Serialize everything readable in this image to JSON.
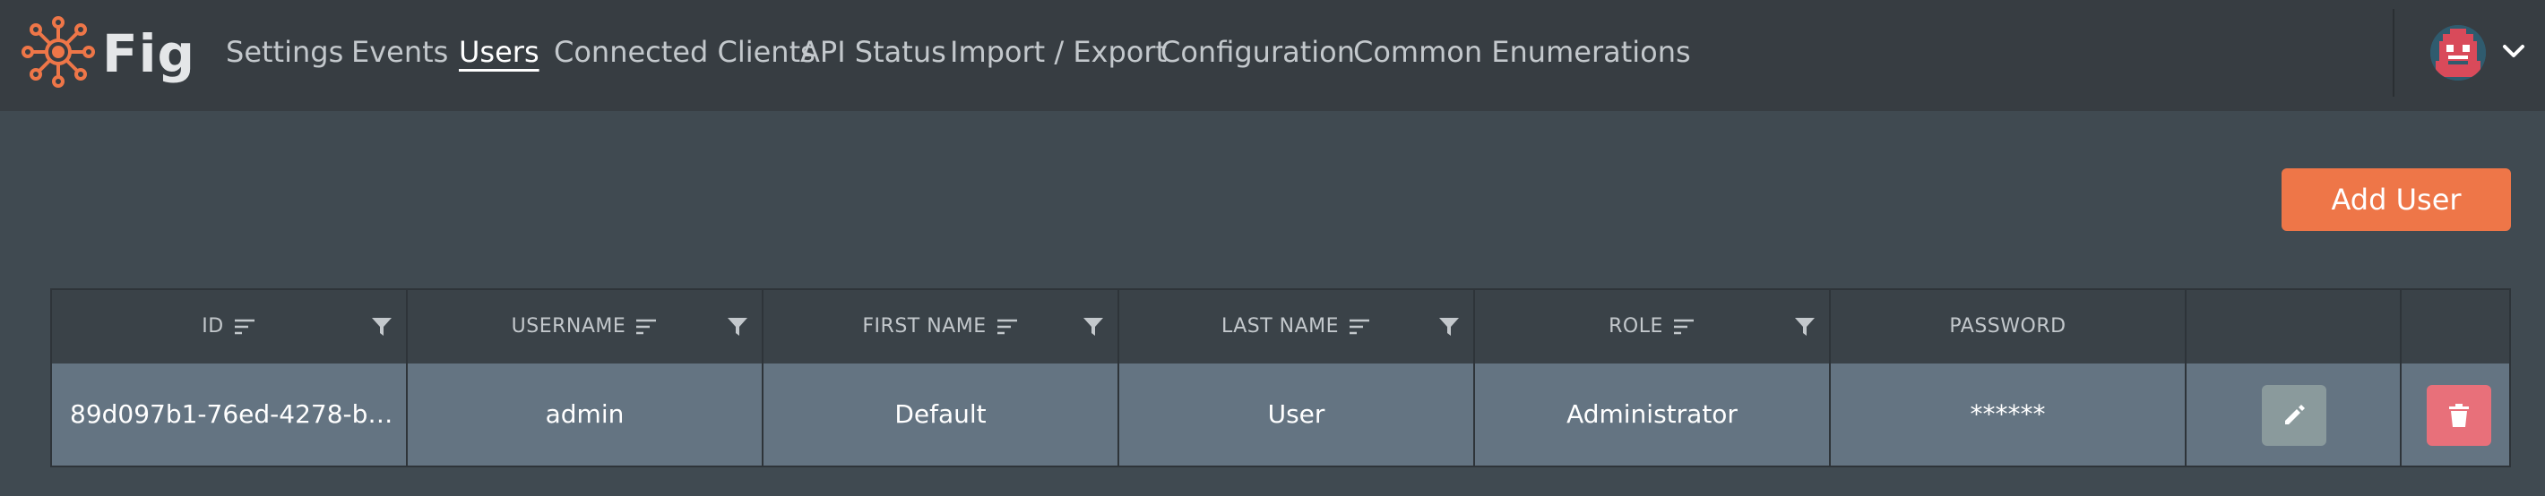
{
  "app": {
    "brand": "Fig"
  },
  "nav": {
    "items": [
      {
        "label": "Settings",
        "active": false
      },
      {
        "label": "Events",
        "active": false
      },
      {
        "label": "Users",
        "active": true
      },
      {
        "label": "Connected Clients",
        "active": false
      },
      {
        "label": "API Status",
        "active": false
      },
      {
        "label": "Import / Export",
        "active": false
      },
      {
        "label": "Configuration",
        "active": false
      },
      {
        "label": "Common Enumerations",
        "active": false
      }
    ]
  },
  "user_menu": {
    "avatar_icon": "pixel-avatar-icon",
    "menu_icon": "chevron-down-icon"
  },
  "toolbar": {
    "add_label": "Add User"
  },
  "table": {
    "columns": [
      {
        "label": "ID",
        "sortable": true,
        "filterable": true
      },
      {
        "label": "USERNAME",
        "sortable": true,
        "filterable": true
      },
      {
        "label": "FIRST NAME",
        "sortable": true,
        "filterable": true
      },
      {
        "label": "LAST NAME",
        "sortable": true,
        "filterable": true
      },
      {
        "label": "ROLE",
        "sortable": true,
        "filterable": true
      },
      {
        "label": "PASSWORD",
        "sortable": false,
        "filterable": false
      },
      {
        "label": "",
        "sortable": false,
        "filterable": false
      },
      {
        "label": "",
        "sortable": false,
        "filterable": false
      }
    ],
    "rows": [
      {
        "id": "89d097b1-76ed-4278-b9dd-…",
        "username": "admin",
        "first_name": "Default",
        "last_name": "User",
        "role": "Administrator",
        "password": "******",
        "edit_icon": "pencil-icon",
        "delete_icon": "trash-icon"
      }
    ]
  },
  "colors": {
    "accent": "#ee7648",
    "nav_bg": "#373d42",
    "page_bg": "#404a51",
    "row_bg": "#647482",
    "edit_btn": "#8a9a9c",
    "delete_btn": "#e8707a"
  }
}
